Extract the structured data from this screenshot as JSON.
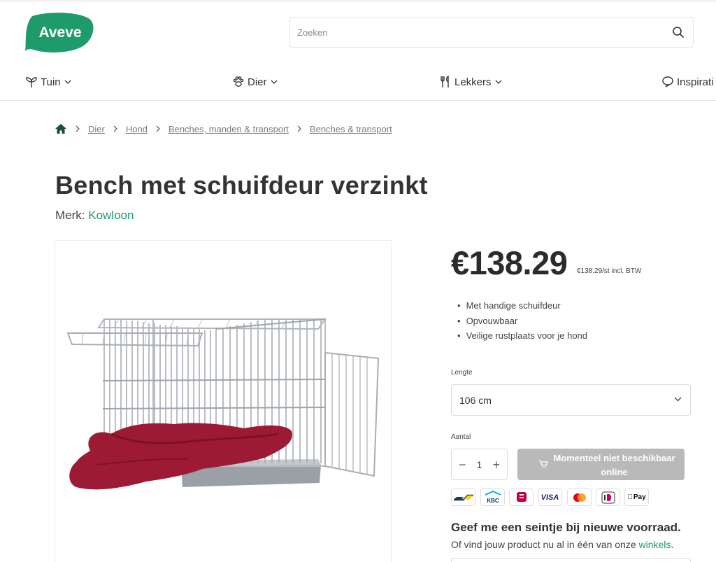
{
  "header": {
    "logo_text": "Aveve",
    "search_placeholder": "Zoeken"
  },
  "nav": {
    "items": [
      {
        "label": "Tuin",
        "icon": "plant-icon"
      },
      {
        "label": "Dier",
        "icon": "paw-icon"
      },
      {
        "label": "Lekkers",
        "icon": "cutlery-icon"
      },
      {
        "label": "Inspirati",
        "icon": "chat-bubble-icon"
      }
    ]
  },
  "breadcrumb": {
    "home_icon": "home-icon",
    "items": [
      "Dier",
      "Hond",
      "Benches, manden & transport",
      "Benches & transport"
    ]
  },
  "product": {
    "title": "Bench met schuifdeur verzinkt",
    "brand_label": "Merk:",
    "brand": "Kowloon",
    "price": "€138.29",
    "unit_price": "€138.29/st incl. BTW",
    "features": [
      "Met handige schuifdeur",
      "Opvouwbaar",
      "Veilige rustplaats voor je hond"
    ],
    "length_label": "Lengte",
    "length_value": "106 cm",
    "quantity_label": "Aantal",
    "quantity": "1",
    "qty_minus": "−",
    "qty_plus": "+",
    "cta_label": "Momenteel niet beschikbaar online",
    "cta_color": "#b9b9b9",
    "payment_methods": [
      "Bancontact",
      "KBC",
      "Belfius",
      "VISA",
      "Mastercard",
      "iDEAL",
      "Pay"
    ],
    "notify_title": "Geef me een seintje bij nieuwe voorraad.",
    "notify_text": "Of vind jouw product nu al in één van onze",
    "notify_link": "winkels",
    "notify_end": "."
  },
  "colors": {
    "brand_green": "#1f9a6b",
    "text": "#333333"
  }
}
